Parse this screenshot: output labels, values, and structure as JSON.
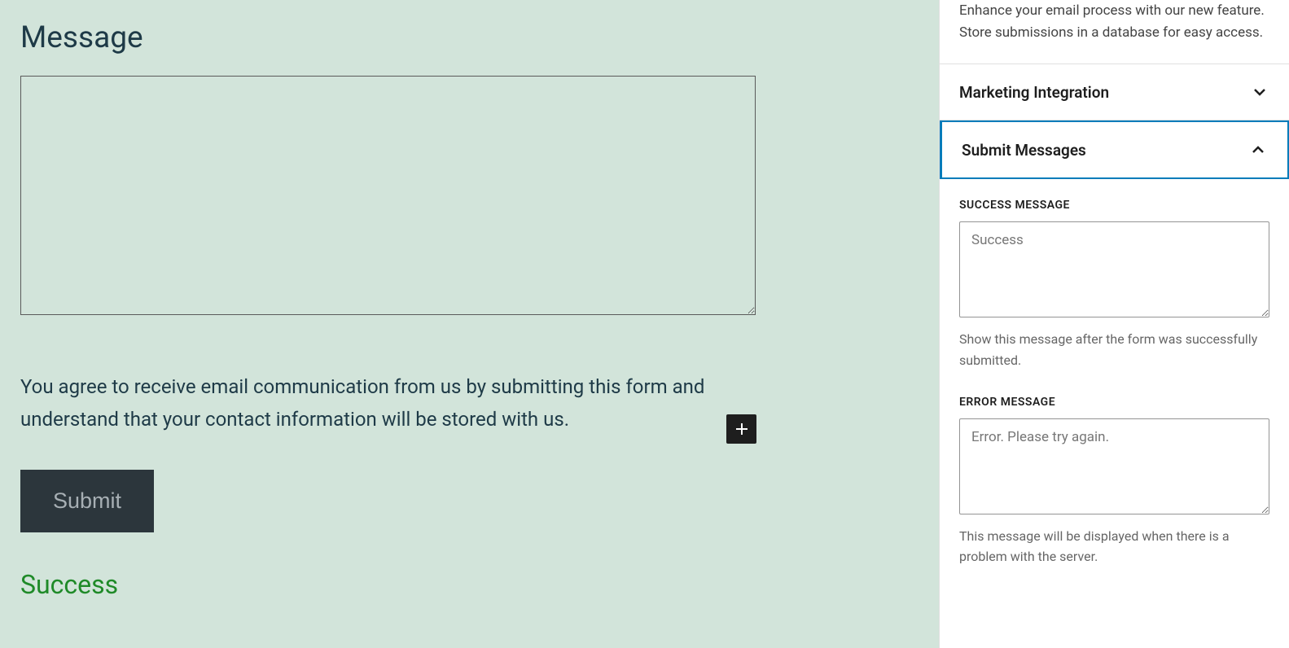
{
  "editor": {
    "message_label": "Message",
    "message_value": "",
    "consent_text": "You agree to receive email communication from us by submitting this form and understand that your contact information will be stored with us.",
    "submit_label": "Submit",
    "success_preview": "Success"
  },
  "sidebar": {
    "top_text": "Enhance your email process with our new feature. Store submissions in a database for easy access.",
    "panels": {
      "marketing": {
        "title": "Marketing Integration"
      },
      "submit_messages": {
        "title": "Submit Messages",
        "success_label": "SUCCESS MESSAGE",
        "success_value": "Success",
        "success_description": "Show this message after the form was successfully submitted.",
        "error_label": "ERROR MESSAGE",
        "error_value": "Error. Please try again.",
        "error_description": "This message will be displayed when there is a problem with the server."
      }
    }
  }
}
